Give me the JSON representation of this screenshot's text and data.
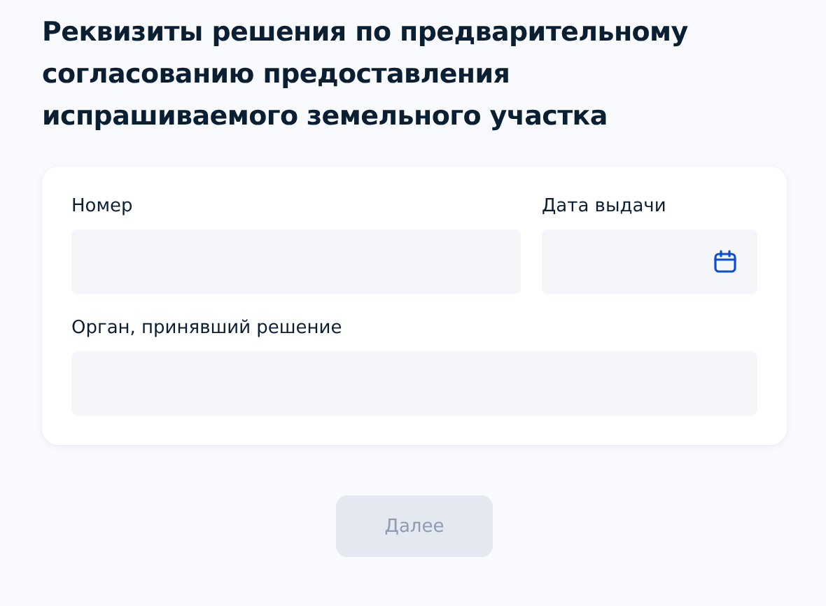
{
  "title": "Реквизиты решения по предварительному согласованию предоставления испрашиваемого земельного участка",
  "rows": [
    {
      "fields": [
        {
          "label": "Номер",
          "kind": "text"
        },
        {
          "label": "Дата выдачи",
          "kind": "date"
        }
      ]
    },
    {
      "fields": [
        {
          "label": "Орган, принявший решение",
          "kind": "text"
        }
      ]
    }
  ],
  "button": {
    "label": "Далее",
    "disabled": true
  }
}
